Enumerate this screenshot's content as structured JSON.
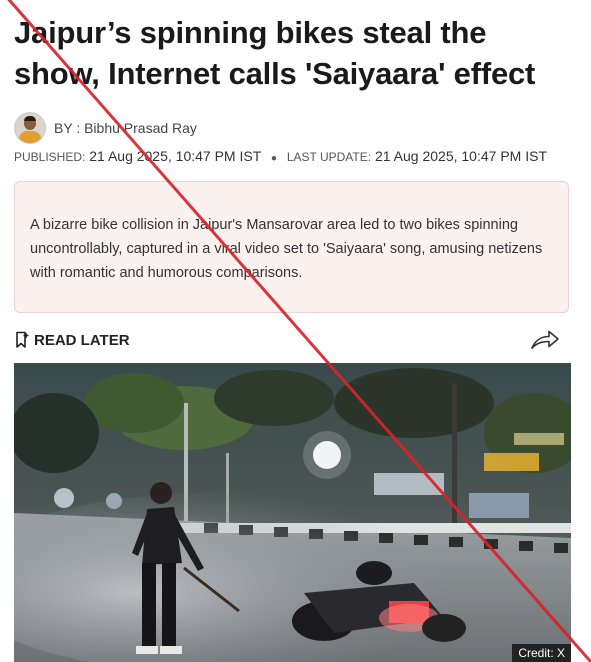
{
  "article": {
    "headline": "Jaipur’s spinning bikes steal the show, Internet calls 'Saiyaara' effect",
    "byline": "BY : Bibhu Prasad Ray",
    "published_label": "PUBLISHED:",
    "published_value": "21 Aug 2025, 10:47 PM IST",
    "updated_label": "LAST UPDATE:",
    "updated_value": "21 Aug 2025, 10:47 PM IST",
    "summary": "A bizarre bike collision in Jaipur's Mansarovar area led to two bikes spinning uncontrollably, captured in a viral video set to 'Saiyaara' song, amusing netizens with romantic and humorous comparisons."
  },
  "toolbar": {
    "read_later_label": "READ LATER",
    "read_later_icon": "bookmark-plus-icon",
    "share_icon": "share-arrow-icon"
  },
  "image": {
    "credit": "Credit: X"
  },
  "overlay": {
    "type": "red-diagonal-cross",
    "color": "#d8232a"
  }
}
